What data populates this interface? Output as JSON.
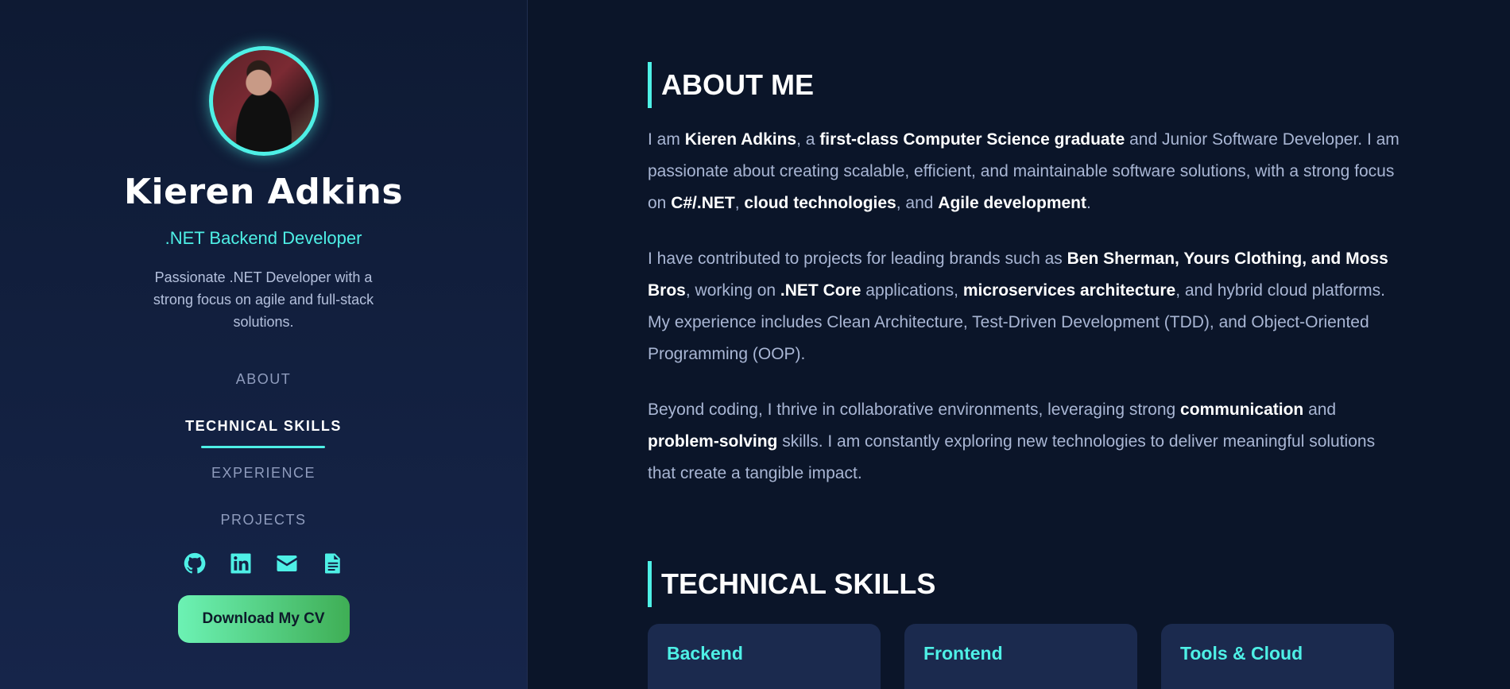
{
  "sidebar": {
    "name": "Kieren Adkins",
    "role": ".NET Backend Developer",
    "tagline": "Passionate .NET Developer with a strong focus on agile and full-stack solutions.",
    "nav": [
      {
        "label": "ABOUT",
        "active": false
      },
      {
        "label": "TECHNICAL SKILLS",
        "active": true
      },
      {
        "label": "EXPERIENCE",
        "active": false
      },
      {
        "label": "PROJECTS",
        "active": false
      }
    ],
    "socials": [
      "github-icon",
      "linkedin-icon",
      "envelope-icon",
      "document-icon"
    ],
    "cv_button": "Download My CV"
  },
  "about": {
    "title": "ABOUT ME",
    "p1": {
      "t1": "I am ",
      "b1": "Kieren Adkins",
      "t2": ", a ",
      "b2": "first-class Computer Science graduate",
      "t3": " and Junior Software Developer. I am passionate about creating scalable, efficient, and maintainable software solutions, with a strong focus on ",
      "b3": "C#/.NET",
      "t4": ", ",
      "b4": "cloud technologies",
      "t5": ", and ",
      "b5": "Agile development",
      "t6": "."
    },
    "p2": {
      "t1": "I have contributed to projects for leading brands such as ",
      "b1": "Ben Sherman, Yours Clothing, and Moss Bros",
      "t2": ", working on ",
      "b2": ".NET Core",
      "t3": " applications, ",
      "b3": "microservices architecture",
      "t4": ", and hybrid cloud platforms. My experience includes Clean Architecture, Test-Driven Development (TDD), and Object-Oriented Programming (OOP)."
    },
    "p3": {
      "t1": "Beyond coding, I thrive in collaborative environments, leveraging strong ",
      "b1": "communication",
      "t2": " and ",
      "b2": "problem-solving",
      "t3": " skills. I am constantly exploring new technologies to deliver meaningful solutions that create a tangible impact."
    }
  },
  "skills": {
    "title": "TECHNICAL SKILLS",
    "cards": [
      "Backend",
      "Frontend",
      "Tools & Cloud"
    ]
  },
  "colors": {
    "accent": "#4ef0e6",
    "background": "#0b1529",
    "card": "#1b2a4e"
  }
}
